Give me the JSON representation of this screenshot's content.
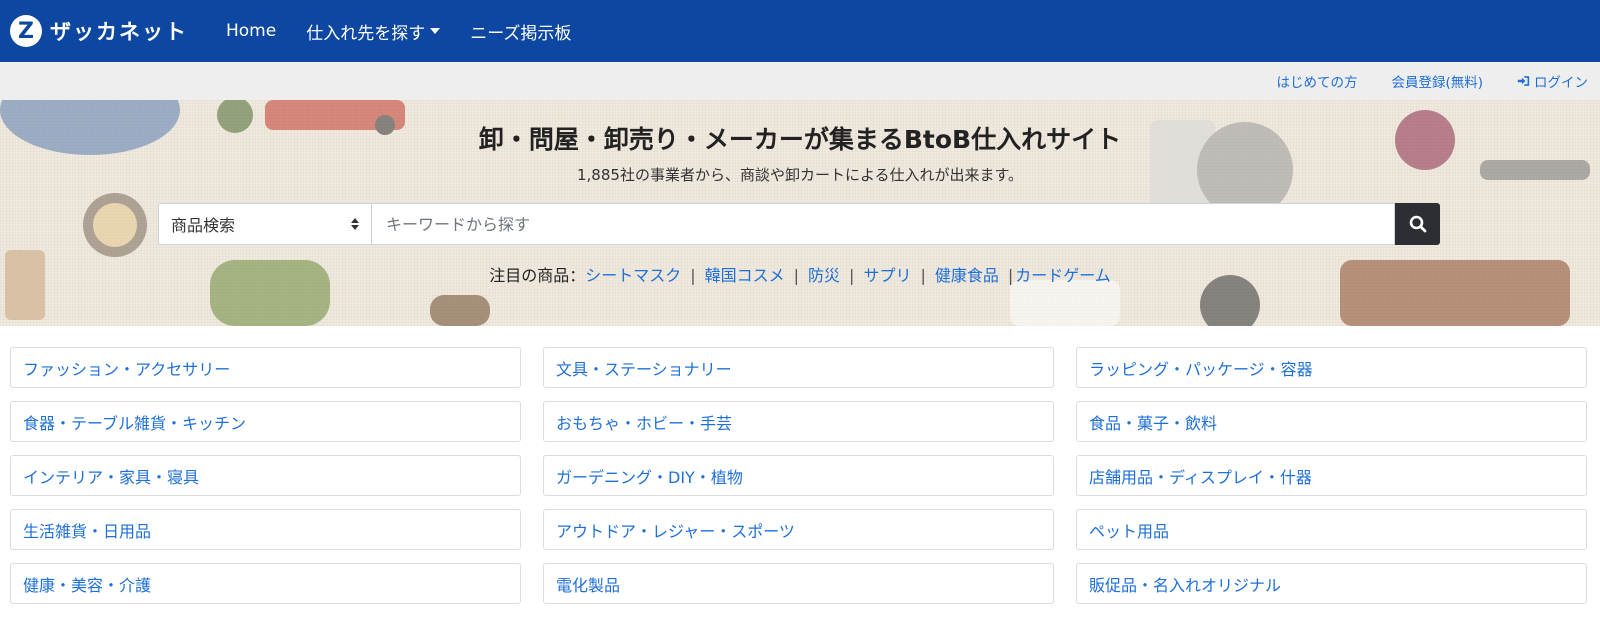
{
  "brand": {
    "logo_letter": "Z",
    "name": "ザッカネット"
  },
  "nav": {
    "home": "Home",
    "find_suppliers": "仕入れ先を探す",
    "needs_board": "ニーズ掲示板"
  },
  "subnav": {
    "first_time": "はじめての方",
    "register": "会員登録(無料)",
    "login": "ログイン"
  },
  "hero": {
    "title": "卸・問屋・卸売り・メーカーが集まるBtoB仕入れサイト",
    "subtitle": "1,885社の事業者から、商談や卸カートによる仕入れが出来ます。",
    "search_select_value": "商品検索",
    "search_placeholder": "キーワードから探す",
    "hot_label": "注目の商品：",
    "hot_items": [
      "シートマスク",
      "韓国コスメ",
      "防災",
      "サプリ",
      "健康食品",
      "カードゲーム"
    ]
  },
  "categories": [
    "ファッション・アクセサリー",
    "文具・ステーショナリー",
    "ラッピング・パッケージ・容器",
    "食器・テーブル雑貨・キッチン",
    "おもちゃ・ホビー・手芸",
    "食品・菓子・飲料",
    "インテリア・家具・寝具",
    "ガーデニング・DIY・植物",
    "店舗用品・ディスプレイ・什器",
    "生活雑貨・日用品",
    "アウトドア・レジャー・スポーツ",
    "ペット用品",
    "健康・美容・介護",
    "電化製品",
    "販促品・名入れオリジナル"
  ],
  "colors": {
    "navbar": "#0d47a1",
    "link": "#1e6fd9",
    "search_button": "#2b2f33",
    "subbar": "#eeeeee"
  },
  "icons": {
    "search_button": "search-icon",
    "login": "sign-in-icon",
    "dropdown": "caret-down-icon"
  }
}
